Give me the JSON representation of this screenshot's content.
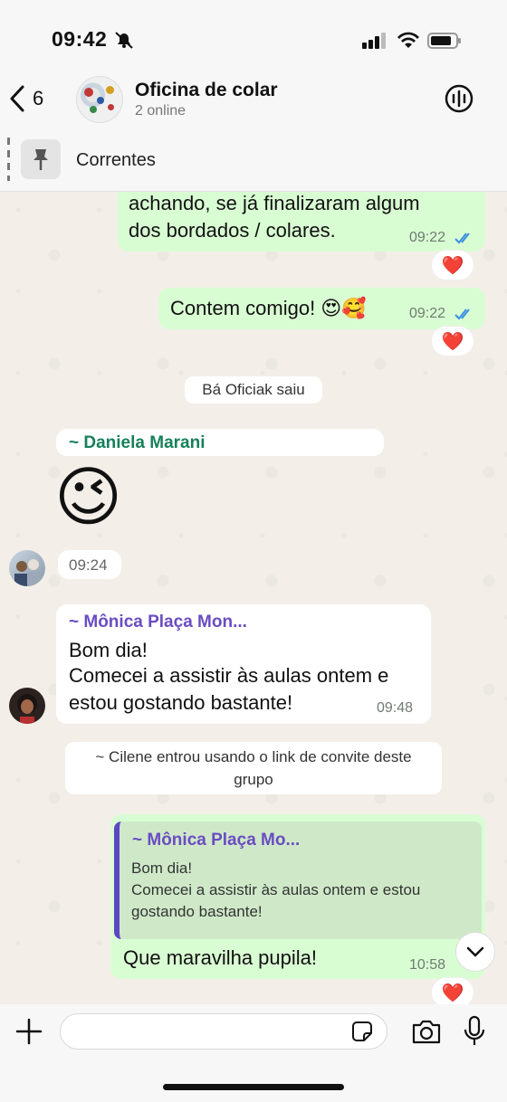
{
  "status": {
    "time": "09:42"
  },
  "header": {
    "back_count": "6",
    "title": "Oficina de colar",
    "subtitle": "2 online"
  },
  "pinned": {
    "label": "Correntes"
  },
  "messages": {
    "m1": {
      "line1": "achando, se já finalizaram algum",
      "line2": "dos bordados / colares.",
      "time": "09:22",
      "reaction": "❤️"
    },
    "m2": {
      "text": "Contem comigo! 😍🥰",
      "time": "09:22",
      "reaction": "❤️"
    },
    "sys1": "Bá Oficiak saiu",
    "m3": {
      "sender": "~ Daniela Marani",
      "emoji": "😉",
      "time": "09:24"
    },
    "m4": {
      "sender": "~ Mônica Plaça Mon...",
      "line1": "Bom dia!",
      "line2": "Comecei a assistir às aulas ontem e",
      "line3": "estou gostando bastante!",
      "time": "09:48"
    },
    "sys2": {
      "line1": "~ Cilene entrou usando o link de convite deste",
      "line2": "grupo"
    },
    "m5": {
      "quote_sender": "~ Mônica Plaça Mo...",
      "quote_line1": "Bom dia!",
      "quote_line2": "Comecei a assistir às aulas ontem e estou",
      "quote_line3": "gostando bastante!",
      "text": "Que maravilha pupila!",
      "time": "10:58",
      "reaction": "❤️"
    }
  },
  "input": {
    "placeholder": ""
  },
  "colors": {
    "outgoing": "#d9fdd3",
    "incoming": "#ffffff",
    "tick_blue": "#3a8fe0",
    "quote_border": "#5b46c4"
  }
}
